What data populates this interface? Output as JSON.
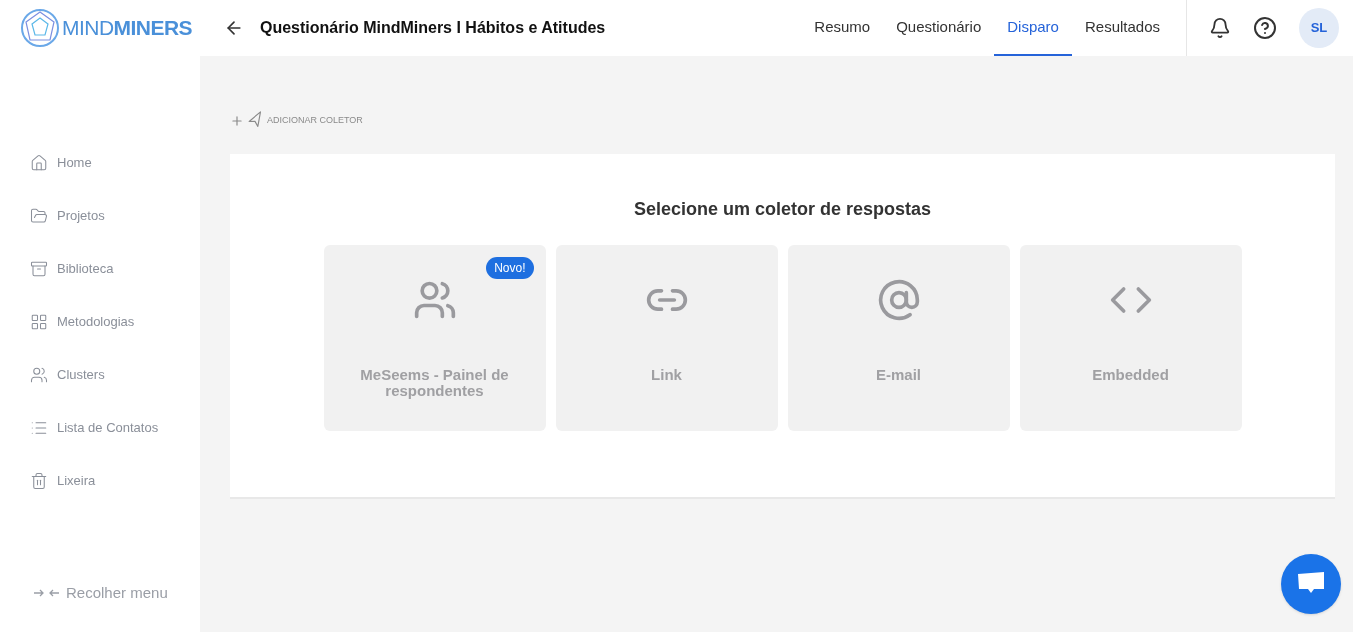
{
  "logo": {
    "text_light": "MIND",
    "text_bold": "MINERS"
  },
  "header": {
    "title": "Questionário MindMiners I Hábitos e Atitudes"
  },
  "tabs": [
    {
      "label": "Resumo",
      "selected": false
    },
    {
      "label": "Questionário",
      "selected": false
    },
    {
      "label": "Disparo",
      "selected": true
    },
    {
      "label": "Resultados",
      "selected": false
    }
  ],
  "avatar": "SL",
  "sidebar": {
    "items": [
      {
        "label": "Home",
        "kind": "home"
      },
      {
        "label": "Projetos",
        "kind": "folder"
      },
      {
        "label": "Biblioteca",
        "kind": "library"
      },
      {
        "label": "Metodologias",
        "kind": "grid"
      },
      {
        "label": "Clusters",
        "kind": "users"
      },
      {
        "label": "Lista de Contatos",
        "kind": "list"
      },
      {
        "label": "Lixeira",
        "kind": "trash"
      }
    ],
    "collapse": "Recolher menu"
  },
  "add_collector": "ADICIONAR COLETOR",
  "panel": {
    "title": "Selecione um coletor de respostas",
    "collectors": [
      {
        "label": "MeSeems - Painel de respondentes",
        "kind": "panel",
        "badge": "Novo!"
      },
      {
        "label": "Link",
        "kind": "link"
      },
      {
        "label": "E-mail",
        "kind": "email"
      },
      {
        "label": "Embedded",
        "kind": "embed"
      }
    ]
  }
}
